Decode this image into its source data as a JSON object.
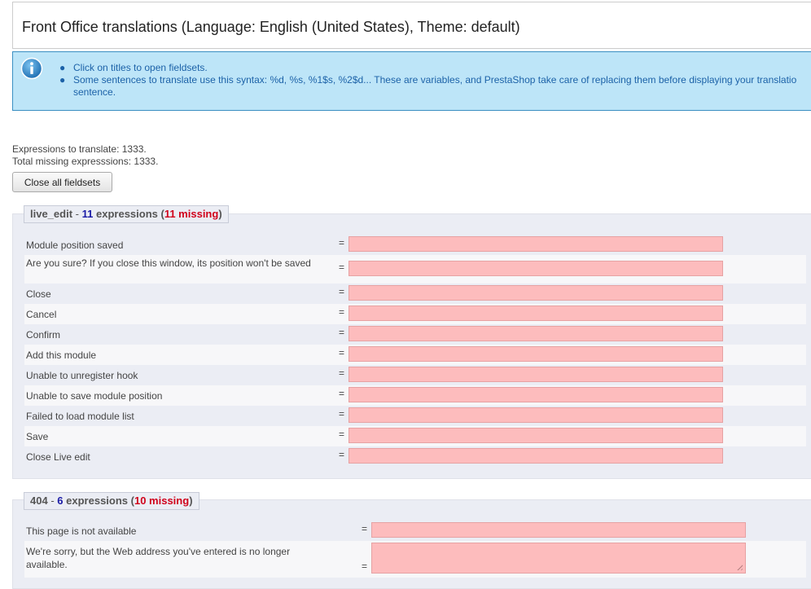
{
  "page_title": "Front Office translations (Language: English (United States), Theme: default)",
  "info": {
    "items": [
      "Click on titles to open fieldsets.",
      "Some sentences to translate use this syntax: %d, %s, %1$s, %2$d... These are variables, and PrestaShop take care of replacing them before displaying your translatio"
    ],
    "item2_continued": "sentence."
  },
  "stats": {
    "expressions": "Expressions to translate: 1333.",
    "missing": "Total missing expresssions: 1333."
  },
  "close_all_button": "Close all fieldsets",
  "fieldsets": [
    {
      "name": "live_edit",
      "count": "11",
      "expressions_label": "expressions",
      "missing": "11 missing",
      "rows": [
        "Module position saved",
        "Are you sure? If you close this window, its position won't be saved",
        "Close",
        "Cancel",
        "Confirm",
        "Add this module",
        "Unable to unregister hook",
        "Unable to save module position",
        "Failed to load module list",
        "Save",
        "Close Live edit"
      ]
    },
    {
      "name": "404",
      "count": "6",
      "expressions_label": "expressions",
      "missing": "10 missing",
      "rows": [
        "This page is not available",
        "We're sorry, but the Web address you've entered is no longer available."
      ]
    }
  ],
  "separator": "-",
  "equals": "=",
  "colors": {
    "info_bg": "#bde5f8",
    "info_text": "#1c62a8",
    "fieldset_bg": "#ebedf4",
    "missing_input_bg": "#fdbcbd",
    "count_blue": "#1a1aa6",
    "missing_red": "#d0021b"
  },
  "icons": [
    "info-icon",
    "resize-grip-icon"
  ]
}
